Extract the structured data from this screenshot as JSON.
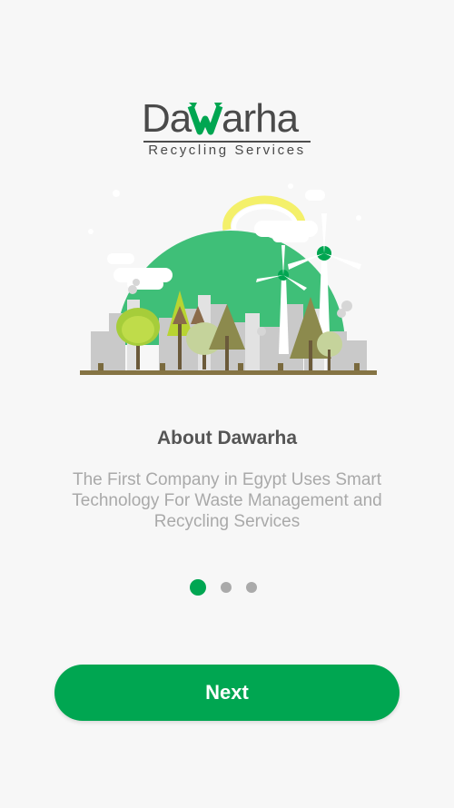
{
  "logo": {
    "brand_text": "Dawarha",
    "subtitle": "Recycling Services"
  },
  "onboarding": {
    "title": "About Dawarha",
    "description": "The First Company in Egypt Uses Smart Technology For Waste Management and Recycling Services",
    "page_count": 3,
    "active_page": 1
  },
  "actions": {
    "next_label": "Next"
  },
  "colors": {
    "brand_green": "#00a651",
    "text_dark": "#555555",
    "text_muted": "#a9a9a9",
    "inactive_dot": "#aaaaaa",
    "background": "#f7f7f7"
  },
  "icons": {
    "illustration": "green-city-windmill-illustration",
    "logo": "dawarha-logo"
  }
}
